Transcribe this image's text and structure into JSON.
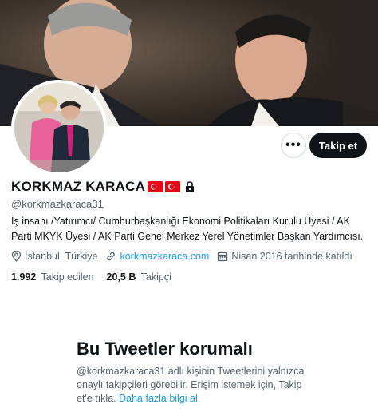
{
  "profile": {
    "name": "KORKMAZ KARACA",
    "handle": "@korkmazkaraca31",
    "bio": "İş insanı /Yatırımcı/ Cumhurbaşkanlığı Ekonomi Politikaları Kurulu Üyesi / AK Parti MKYK Üyesi / AK Parti Genel Merkez Yerel Yönetimler Başkan Yardımcısı.",
    "location": "İstanbul, Türkiye",
    "website": "korkmazkaraca.com",
    "joined": "Nisan 2016 tarihinde katıldı"
  },
  "stats": {
    "following_count": "1.992",
    "following_label": "Takip edilen",
    "followers_count": "20,5 B",
    "followers_label": "Takipçi"
  },
  "actions": {
    "more_label": "•••",
    "follow_label": "Takip et"
  },
  "protected": {
    "title": "Bu Tweetler korumalı",
    "body": "@korkmazkaraca31 adlı kişinin Tweetlerini yalnızca onaylı takipçileri görebilir. Erişim istemek için, Takip et'e tıkla. ",
    "link": "Daha fazla bilgi al"
  },
  "colors": {
    "accent": "#1d9bf0",
    "text": "#0f1419",
    "muted": "#536471",
    "flag_red": "#e30a17"
  },
  "icons": [
    "flag-turkey-icon",
    "lock-icon",
    "location-icon",
    "link-icon",
    "calendar-icon",
    "more-icon"
  ]
}
